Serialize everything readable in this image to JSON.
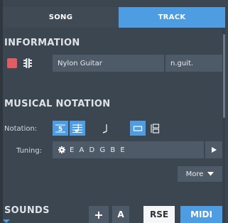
{
  "tabs": {
    "song_label": "SONG",
    "track_label": "TRACK",
    "active": "TRACK"
  },
  "information": {
    "title": "INFORMATION",
    "track_color": "#e25d63",
    "instrument_icon": "guitar-head-icon",
    "track_name": "Nylon Guitar",
    "short_name": "n.guit."
  },
  "notation": {
    "title": "MUSICAL NOTATION",
    "notation_label": "Notation:",
    "buttons": [
      {
        "name": "tablature",
        "icon": "tab-5-icon",
        "active": true
      },
      {
        "name": "standard",
        "icon": "standard-notation-icon",
        "active": true
      },
      {
        "name": "slash",
        "icon": "slash-note-icon",
        "active": false
      },
      {
        "name": "single-staff",
        "icon": "single-staff-icon",
        "active": true
      },
      {
        "name": "multi-staff",
        "icon": "multi-staff-icon",
        "active": false
      }
    ],
    "tuning_label": "Tuning:",
    "tuning_value": "E A D G B E",
    "tuning_settings_icon": "gear-icon",
    "play_icon": "play-icon",
    "more_label": "More",
    "more_icon": "caret-down-icon"
  },
  "sounds": {
    "title": "SOUNDS",
    "add_label": "+",
    "automation_label": "A",
    "rse_label": "RSE",
    "midi_label": "MIDI",
    "active": "MIDI"
  },
  "colors": {
    "panel_bg": "#3c4650",
    "field_bg": "#4e5a67",
    "accent": "#4e9de2",
    "swatch": "#e25d63"
  }
}
